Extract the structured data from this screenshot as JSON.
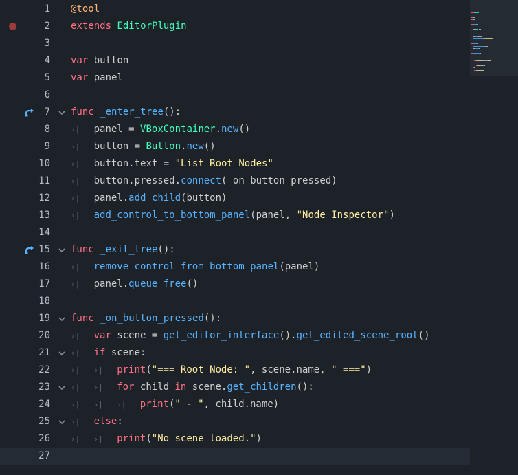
{
  "editor": {
    "current_line": 27,
    "colors": {
      "keyword": "#ff7085",
      "annotation": "#ffb373",
      "type": "#42ffc2",
      "function": "#57b3ff",
      "string": "#ffeda1",
      "text": "#cdcfd2"
    },
    "lines": [
      {
        "num": "1",
        "indent": 0,
        "tokens": [
          {
            "t": "@tool",
            "c": "an"
          }
        ]
      },
      {
        "num": "2",
        "indent": 0,
        "breakpoint": true,
        "tokens": [
          {
            "t": "extends",
            "c": "kw"
          },
          {
            "t": " ",
            "c": "tx"
          },
          {
            "t": "EditorPlugin",
            "c": "ty"
          }
        ]
      },
      {
        "num": "3",
        "indent": 0,
        "tokens": []
      },
      {
        "num": "4",
        "indent": 0,
        "tokens": [
          {
            "t": "var",
            "c": "kw"
          },
          {
            "t": " button",
            "c": "tx"
          }
        ]
      },
      {
        "num": "5",
        "indent": 0,
        "tokens": [
          {
            "t": "var",
            "c": "kw"
          },
          {
            "t": " panel",
            "c": "tx"
          }
        ]
      },
      {
        "num": "6",
        "indent": 0,
        "tokens": []
      },
      {
        "num": "7",
        "indent": 0,
        "override": true,
        "fold": true,
        "tokens": [
          {
            "t": "func",
            "c": "kw"
          },
          {
            "t": " ",
            "c": "tx"
          },
          {
            "t": "_enter_tree",
            "c": "fn"
          },
          {
            "t": "():",
            "c": "tx"
          }
        ]
      },
      {
        "num": "8",
        "indent": 1,
        "tokens": [
          {
            "t": "panel = ",
            "c": "tx"
          },
          {
            "t": "VBoxContainer",
            "c": "ty"
          },
          {
            "t": ".",
            "c": "tx"
          },
          {
            "t": "new",
            "c": "fn"
          },
          {
            "t": "()",
            "c": "tx"
          }
        ]
      },
      {
        "num": "9",
        "indent": 1,
        "tokens": [
          {
            "t": "button = ",
            "c": "tx"
          },
          {
            "t": "Button",
            "c": "ty"
          },
          {
            "t": ".",
            "c": "tx"
          },
          {
            "t": "new",
            "c": "fn"
          },
          {
            "t": "()",
            "c": "tx"
          }
        ]
      },
      {
        "num": "10",
        "indent": 1,
        "tokens": [
          {
            "t": "button.text = ",
            "c": "tx"
          },
          {
            "t": "\"List Root Nodes\"",
            "c": "st"
          }
        ]
      },
      {
        "num": "11",
        "indent": 1,
        "tokens": [
          {
            "t": "button.pressed.",
            "c": "tx"
          },
          {
            "t": "connect",
            "c": "fn"
          },
          {
            "t": "(_on_button_pressed)",
            "c": "tx"
          }
        ]
      },
      {
        "num": "12",
        "indent": 1,
        "tokens": [
          {
            "t": "panel.",
            "c": "tx"
          },
          {
            "t": "add_child",
            "c": "fn"
          },
          {
            "t": "(button)",
            "c": "tx"
          }
        ]
      },
      {
        "num": "13",
        "indent": 1,
        "tokens": [
          {
            "t": "add_control_to_bottom_panel",
            "c": "fn"
          },
          {
            "t": "(panel, ",
            "c": "tx"
          },
          {
            "t": "\"Node Inspector\"",
            "c": "st"
          },
          {
            "t": ")",
            "c": "tx"
          }
        ]
      },
      {
        "num": "14",
        "indent": 0,
        "tokens": []
      },
      {
        "num": "15",
        "indent": 0,
        "override": true,
        "fold": true,
        "tokens": [
          {
            "t": "func",
            "c": "kw"
          },
          {
            "t": " ",
            "c": "tx"
          },
          {
            "t": "_exit_tree",
            "c": "fn"
          },
          {
            "t": "():",
            "c": "tx"
          }
        ]
      },
      {
        "num": "16",
        "indent": 1,
        "tokens": [
          {
            "t": "remove_control_from_bottom_panel",
            "c": "fn"
          },
          {
            "t": "(panel)",
            "c": "tx"
          }
        ]
      },
      {
        "num": "17",
        "indent": 1,
        "tokens": [
          {
            "t": "panel.",
            "c": "tx"
          },
          {
            "t": "queue_free",
            "c": "fn"
          },
          {
            "t": "()",
            "c": "tx"
          }
        ]
      },
      {
        "num": "18",
        "indent": 0,
        "tokens": []
      },
      {
        "num": "19",
        "indent": 0,
        "fold": true,
        "tokens": [
          {
            "t": "func",
            "c": "kw"
          },
          {
            "t": " ",
            "c": "tx"
          },
          {
            "t": "_on_button_pressed",
            "c": "fn"
          },
          {
            "t": "():",
            "c": "tx"
          }
        ]
      },
      {
        "num": "20",
        "indent": 1,
        "tokens": [
          {
            "t": "var",
            "c": "kw"
          },
          {
            "t": " scene = ",
            "c": "tx"
          },
          {
            "t": "get_editor_interface",
            "c": "fn"
          },
          {
            "t": "().",
            "c": "tx"
          },
          {
            "t": "get_edited_scene_root",
            "c": "fn"
          },
          {
            "t": "()",
            "c": "tx"
          }
        ]
      },
      {
        "num": "21",
        "indent": 1,
        "fold": true,
        "tokens": [
          {
            "t": "if",
            "c": "kw"
          },
          {
            "t": " scene:",
            "c": "tx"
          }
        ]
      },
      {
        "num": "22",
        "indent": 2,
        "tokens": [
          {
            "t": "print",
            "c": "kw"
          },
          {
            "t": "(",
            "c": "tx"
          },
          {
            "t": "\"=== Root Node: \"",
            "c": "st"
          },
          {
            "t": ", scene.name, ",
            "c": "tx"
          },
          {
            "t": "\" ===\"",
            "c": "st"
          },
          {
            "t": ")",
            "c": "tx"
          }
        ]
      },
      {
        "num": "23",
        "indent": 2,
        "fold": true,
        "tokens": [
          {
            "t": "for",
            "c": "kw"
          },
          {
            "t": " child ",
            "c": "tx"
          },
          {
            "t": "in",
            "c": "kw"
          },
          {
            "t": " scene.",
            "c": "tx"
          },
          {
            "t": "get_children",
            "c": "fn"
          },
          {
            "t": "():",
            "c": "tx"
          }
        ]
      },
      {
        "num": "24",
        "indent": 3,
        "tokens": [
          {
            "t": "print",
            "c": "kw"
          },
          {
            "t": "(",
            "c": "tx"
          },
          {
            "t": "\" - \"",
            "c": "st"
          },
          {
            "t": ", child.name)",
            "c": "tx"
          }
        ]
      },
      {
        "num": "25",
        "indent": 1,
        "fold": true,
        "tokens": [
          {
            "t": "else",
            "c": "kw"
          },
          {
            "t": ":",
            "c": "tx"
          }
        ]
      },
      {
        "num": "26",
        "indent": 2,
        "tokens": [
          {
            "t": "print",
            "c": "kw"
          },
          {
            "t": "(",
            "c": "tx"
          },
          {
            "t": "\"No scene loaded.\"",
            "c": "st"
          },
          {
            "t": ")",
            "c": "tx"
          }
        ]
      },
      {
        "num": "27",
        "indent": 0,
        "tokens": []
      }
    ]
  }
}
